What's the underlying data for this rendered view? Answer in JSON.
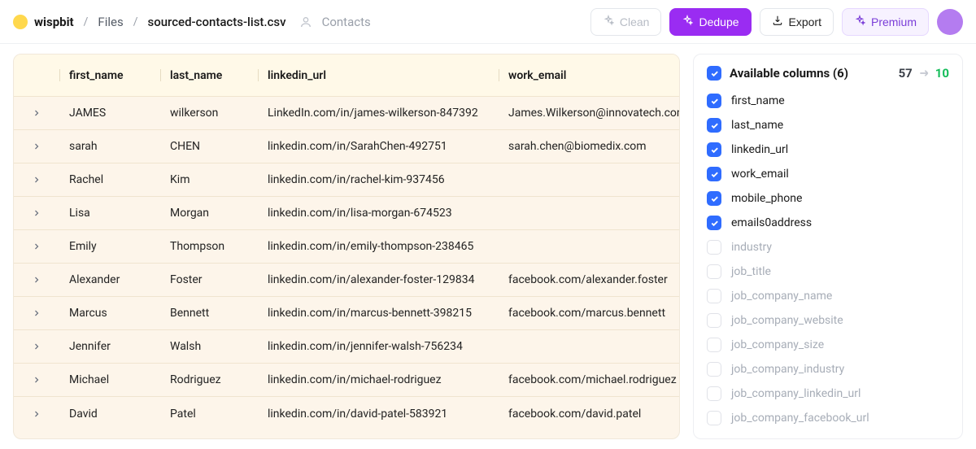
{
  "header": {
    "brand": "wispbit",
    "crumbs": [
      "Files",
      "sourced-contacts-list.csv"
    ],
    "category": "Contacts",
    "buttons": {
      "clean": "Clean",
      "dedupe": "Dedupe",
      "export": "Export",
      "premium": "Premium"
    }
  },
  "table": {
    "columns": [
      "first_name",
      "last_name",
      "linkedin_url",
      "work_email"
    ],
    "rows": [
      {
        "first": "JAMES",
        "last": "wilkerson",
        "link": "LinkedIn.com/in/james-wilkerson-847392",
        "email": "James.Wilkerson@innovatech.com"
      },
      {
        "first": "sarah",
        "last": "CHEN",
        "link": "linkedin.com/in/SarahChen-492751",
        "email": "sarah.chen@biomedix.com"
      },
      {
        "first": "Rachel",
        "last": "Kim",
        "link": "linkedin.com/in/rachel-kim-937456",
        "email": ""
      },
      {
        "first": "Lisa",
        "last": "Morgan",
        "link": "linkedin.com/in/lisa-morgan-674523",
        "email": ""
      },
      {
        "first": "Emily",
        "last": "Thompson",
        "link": "linkedin.com/in/emily-thompson-238465",
        "email": ""
      },
      {
        "first": "Alexander",
        "last": "Foster",
        "link": "linkedin.com/in/alexander-foster-129834",
        "email": "facebook.com/alexander.foster"
      },
      {
        "first": "Marcus",
        "last": "Bennett",
        "link": "linkedin.com/in/marcus-bennett-398215",
        "email": "facebook.com/marcus.bennett"
      },
      {
        "first": "Jennifer",
        "last": "Walsh",
        "link": "linkedin.com/in/jennifer-walsh-756234",
        "email": ""
      },
      {
        "first": "Michael",
        "last": "Rodriguez",
        "link": "linkedin.com/in/michael-rodriguez",
        "email": "facebook.com/michael.rodriguez"
      },
      {
        "first": "David",
        "last": "Patel",
        "link": "linkedin.com/in/david-patel-583921",
        "email": "facebook.com/david.patel"
      }
    ]
  },
  "sidebar": {
    "title": "Available columns (6)",
    "count_from": "57",
    "count_to": "10",
    "items": [
      {
        "label": "first_name",
        "checked": true
      },
      {
        "label": "last_name",
        "checked": true
      },
      {
        "label": "linkedin_url",
        "checked": true
      },
      {
        "label": "work_email",
        "checked": true
      },
      {
        "label": "mobile_phone",
        "checked": true
      },
      {
        "label": "emails0address",
        "checked": true
      },
      {
        "label": "industry",
        "checked": false
      },
      {
        "label": "job_title",
        "checked": false
      },
      {
        "label": "job_company_name",
        "checked": false
      },
      {
        "label": "job_company_website",
        "checked": false
      },
      {
        "label": "job_company_size",
        "checked": false
      },
      {
        "label": "job_company_industry",
        "checked": false
      },
      {
        "label": "job_company_linkedin_url",
        "checked": false
      },
      {
        "label": "job_company_facebook_url",
        "checked": false
      }
    ]
  }
}
